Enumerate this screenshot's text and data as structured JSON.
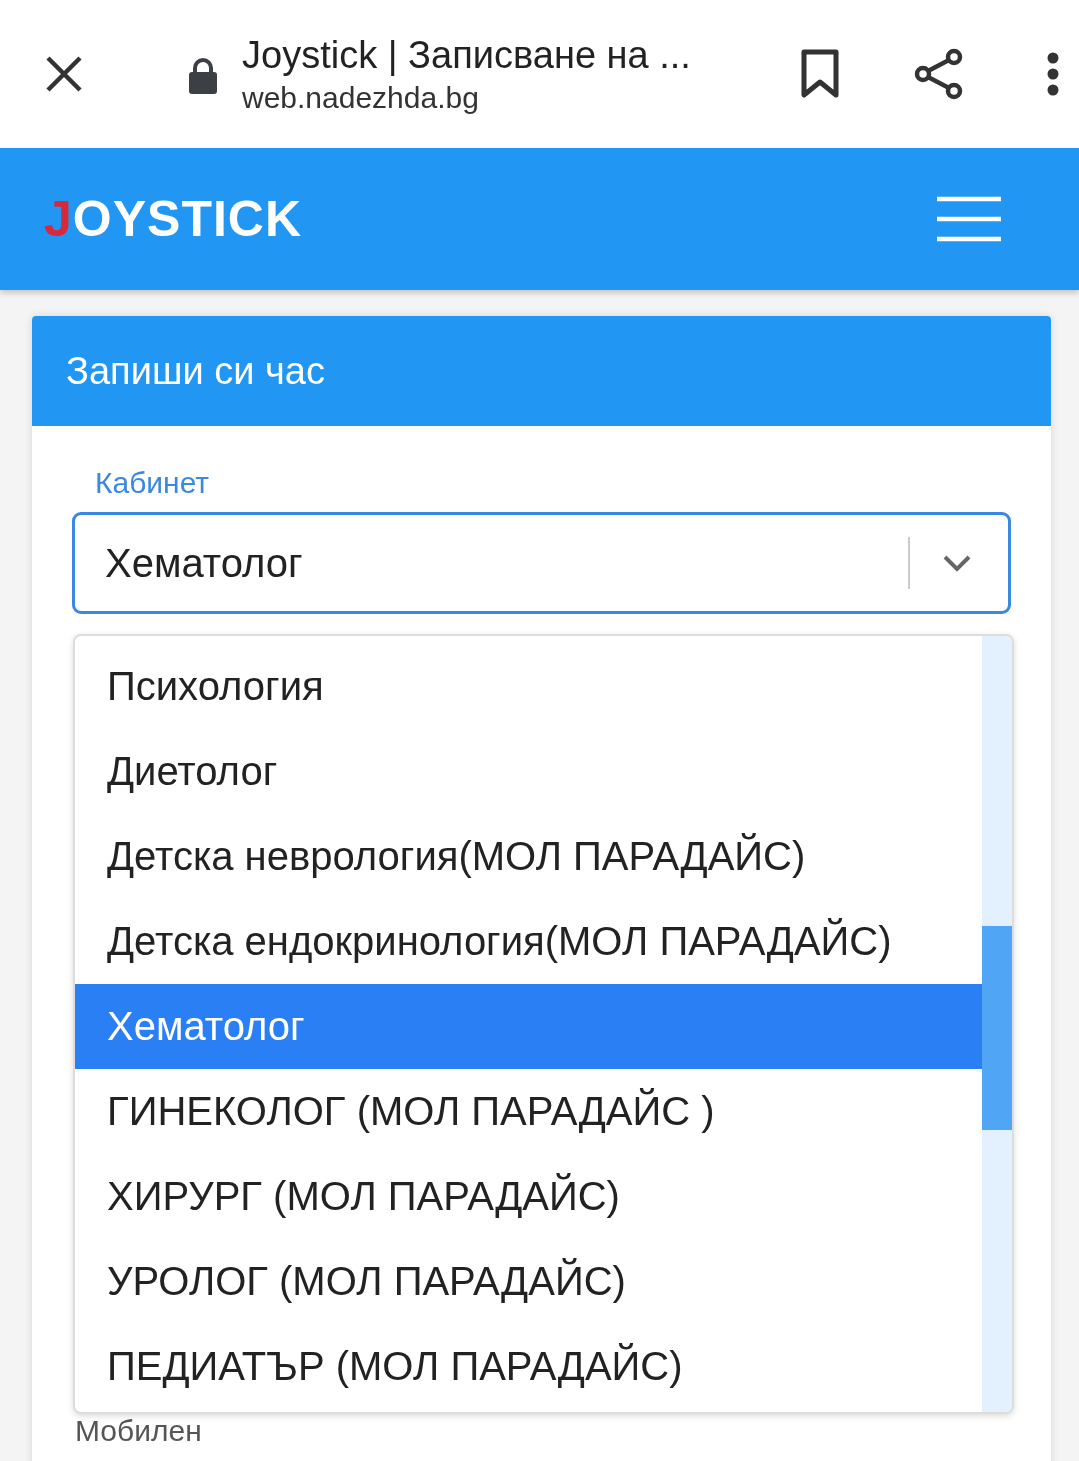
{
  "browser": {
    "title": "Joystick | Записване на ...",
    "url": "web.nadezhda.bg"
  },
  "app": {
    "logo": "JOYSTICK"
  },
  "card": {
    "title": "Запиши си час",
    "field": {
      "label": "Кабинет",
      "value": "Хематолог",
      "expanded": true
    },
    "options": [
      {
        "label": "Психология",
        "selected": false
      },
      {
        "label": "Диетолог",
        "selected": false
      },
      {
        "label": "Детска неврология(МОЛ ПАРАДАЙС)",
        "selected": false
      },
      {
        "label": "Детска ендокринология(МОЛ ПАРАДАЙС)",
        "selected": false
      },
      {
        "label": "Хематолог",
        "selected": true
      },
      {
        "label": "ГИНЕКОЛОГ (МОЛ ПАРАДАЙС )",
        "selected": false
      },
      {
        "label": "ХИРУРГ (МОЛ ПАРАДАЙС)",
        "selected": false
      },
      {
        "label": "УРОЛОГ (МОЛ ПАРАДАЙС)",
        "selected": false
      },
      {
        "label": "ПЕДИАТЪР (МОЛ ПАРАДАЙС)",
        "selected": false
      }
    ],
    "next_label": "Мобилен"
  }
}
